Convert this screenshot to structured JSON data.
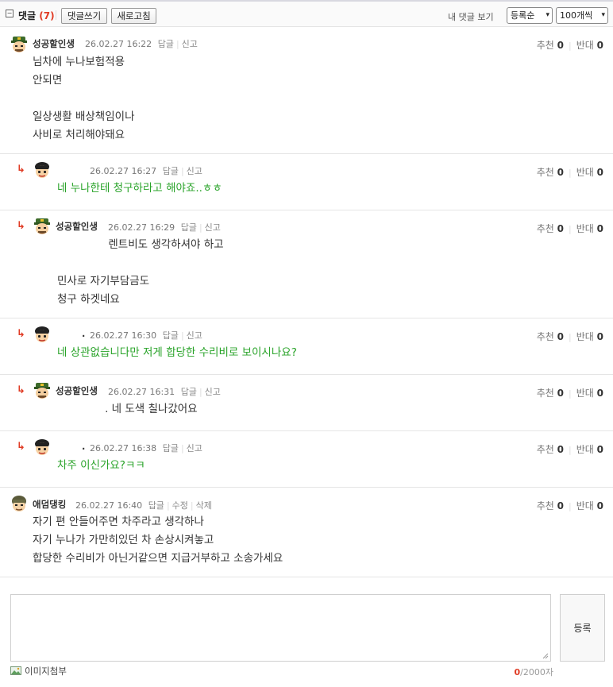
{
  "toolbar": {
    "toggle_icon": "−",
    "title": "댓글",
    "count": "(7)",
    "write_label": "댓글쓰기",
    "refresh_label": "새로고침",
    "my_comments_label": "내 댓글 보기",
    "sort_value": "등록순",
    "page_size_value": "100개씩",
    "dropdown_icon": "▾"
  },
  "vote_labels": {
    "up": "추천",
    "down": "반대"
  },
  "action_labels": {
    "reply": "답글",
    "report": "신고",
    "edit": "수정",
    "delete": "삭제"
  },
  "reply_arrow": "↳",
  "comments": [
    {
      "nick": "성공할인생",
      "date": "26.02.27 16:22",
      "up": "0",
      "down": "0",
      "body": "님차에 누나보험적용\n안되면\n\n일상생활 배상책임이나\n사비로 처리해야돼요"
    },
    {
      "nick": "",
      "date": "26.02.27 16:27",
      "up": "0",
      "down": "0",
      "body": "네 누나한테 청구하라고 해야죠..ㅎㅎ"
    },
    {
      "nick": "성공할인생",
      "date": "26.02.27 16:29",
      "up": "0",
      "down": "0",
      "body": "               렌트비도 생각하셔야 하고\n\n민사로 자기부담금도\n청구 하겟네요"
    },
    {
      "nick": ".",
      "date": "26.02.27 16:30",
      "up": "0",
      "down": "0",
      "body": "네 상관없습니다만 저게 합당한 수리비로 보이시나요?"
    },
    {
      "nick": "성공할인생",
      "date": "26.02.27 16:31",
      "up": "0",
      "down": "0",
      "body": "              . 네 도색 칠나갔어요"
    },
    {
      "nick": ".",
      "date": "26.02.27 16:38",
      "up": "0",
      "down": "0",
      "body": "차주 이신가요?ㅋㅋ"
    },
    {
      "nick": "애덤댕킹",
      "date": "26.02.27 16:40",
      "up": "0",
      "down": "0",
      "body": "자기 편 안들어주면 차주라고 생각하나\n자기 누나가 가만히있던 차 손상시켜놓고\n합당한 수리비가 아닌거같으면 지급거부하고 소송가세요"
    }
  ],
  "form": {
    "submit_label": "등록",
    "attach_label": "이미지첨부",
    "char_count": "0",
    "char_limit": "/2000자"
  },
  "colors": {
    "accent_red": "#e03b24",
    "reply_green": "#29a329"
  }
}
